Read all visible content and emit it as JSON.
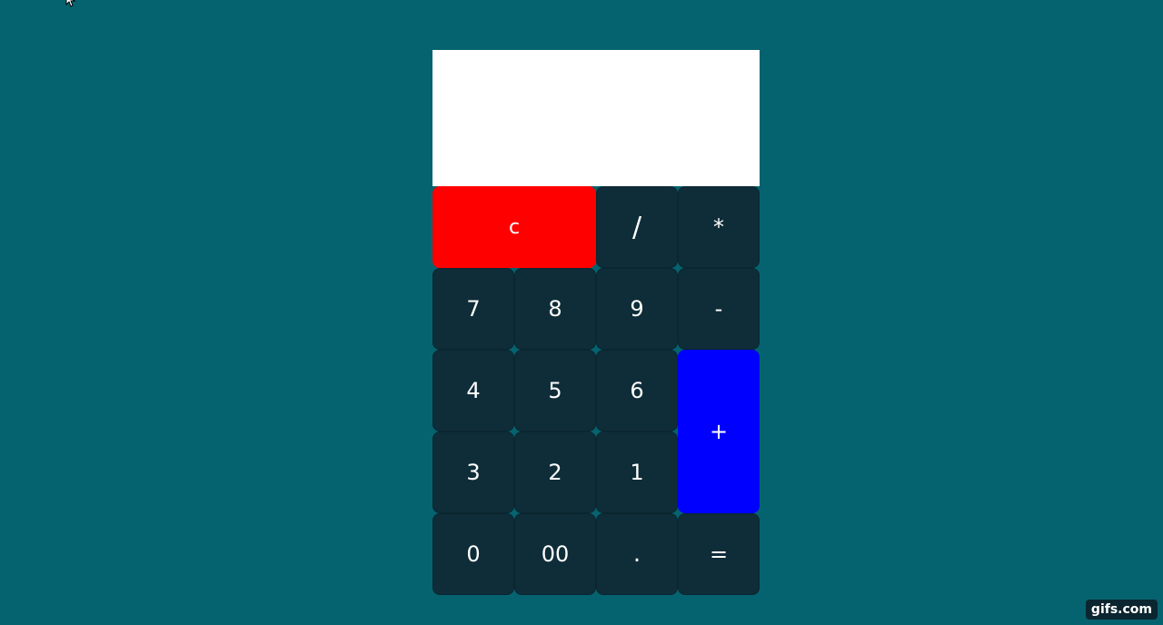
{
  "calculator": {
    "display_value": "",
    "keys": {
      "clear": "c",
      "divide": "/",
      "multiply": "*",
      "seven": "7",
      "eight": "8",
      "nine": "9",
      "minus": "-",
      "four": "4",
      "five": "5",
      "six": "6",
      "plus": "+",
      "three": "3",
      "two": "2",
      "one": "1",
      "zero": "0",
      "double_zero": "00",
      "decimal": ".",
      "equals": "="
    }
  },
  "watermark": "gifs.com",
  "colors": {
    "page_background": "#05636f",
    "display_background": "#ffffff",
    "key_background": "#0f2d38",
    "clear_key": "#ff0000",
    "plus_key": "#0000ff",
    "key_text": "#ffffff"
  },
  "icons": {
    "cursor": "mouse-pointer-icon"
  }
}
